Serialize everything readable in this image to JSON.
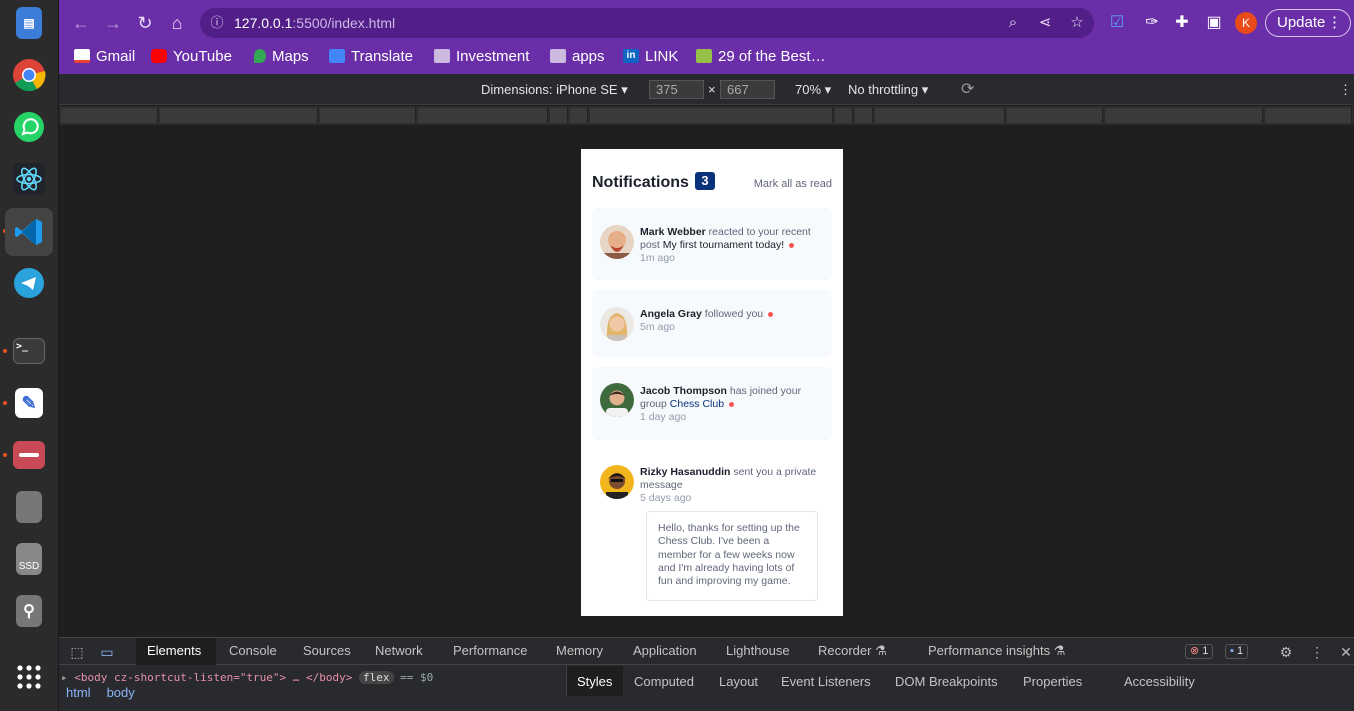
{
  "dock": {
    "apps": [
      "document-viewer-icon",
      "chrome-icon",
      "whatsapp-icon",
      "react-atom-icon",
      "vscode-icon",
      "telegram-icon",
      "terminal-icon",
      "text-editor-icon",
      "files-icon",
      "drive-icon",
      "ssd-icon",
      "usb-icon",
      "app-grid-icon"
    ],
    "ssd_label": "SSD"
  },
  "browser": {
    "url_host": "127.0.0.1",
    "url_rest": ":5500/index.html",
    "profile_initial": "K",
    "update_label": "Update",
    "bookmarks": [
      "Gmail",
      "YouTube",
      "Maps",
      "Translate",
      "Investment",
      "apps",
      "LINK",
      "29 of the Best…"
    ]
  },
  "device_toolbar": {
    "dimensions_label": "Dimensions: iPhone SE",
    "width": "375",
    "height": "667",
    "times": "×",
    "zoom": "70%",
    "throttling": "No throttling"
  },
  "page": {
    "title": "Notifications",
    "count": "3",
    "mark_all": "Mark all as read",
    "notifications": [
      {
        "name": "Mark Webber",
        "action": "reacted to your recent post",
        "target": "My first tournament today!",
        "time": "1m ago",
        "unread": true
      },
      {
        "name": "Angela Gray",
        "action": "followed you",
        "target": "",
        "time": "5m ago",
        "unread": true
      },
      {
        "name": "Jacob Thompson",
        "action": "has joined your group",
        "target": "Chess Club",
        "time": "1 day ago",
        "unread": true
      },
      {
        "name": "Rizky Hasanuddin",
        "action": "sent you a private message",
        "target": "",
        "time": "5 days ago",
        "unread": false
      }
    ],
    "private_message": "Hello, thanks for setting up the Chess Club. I've been a member for a few weeks now and I'm already having lots of fun and improving my game."
  },
  "devtools": {
    "tabs": [
      "Elements",
      "Console",
      "Sources",
      "Network",
      "Performance",
      "Memory",
      "Application",
      "Lighthouse",
      "Recorder",
      "Performance insights"
    ],
    "errors": "1",
    "messages": "1",
    "dom_line": "<body cz-shortcut-listen=\"true\"> … </body>",
    "flex": "flex",
    "eq": "== $0",
    "breadcrumbs": [
      "html",
      "body"
    ],
    "side_tabs": [
      "Styles",
      "Computed",
      "Layout",
      "Event Listeners",
      "DOM Breakpoints",
      "Properties",
      "Accessibility"
    ]
  }
}
